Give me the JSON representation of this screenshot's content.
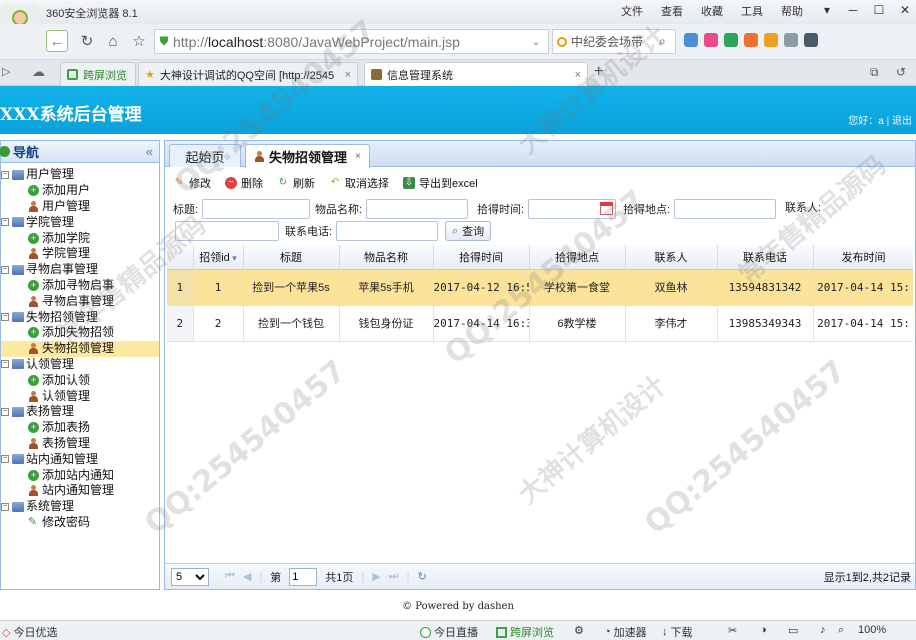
{
  "browser": {
    "name": "360安全浏览器 8.1",
    "menus": [
      "文件",
      "查看",
      "收藏",
      "工具",
      "帮助"
    ],
    "url_prefix": "http://",
    "url_host": "localhost",
    "url_rest": ":8080/JavaWebProject/main.jsp",
    "search_text": "中纪委会场带",
    "tabs": [
      {
        "label": "跨屏浏览"
      },
      {
        "label": "大神设计调试的QQ空间 [http://2545"
      },
      {
        "label": "信息管理系统"
      }
    ]
  },
  "app": {
    "title": "XXX系统后台管理",
    "greeting": "您好：a | 退出"
  },
  "sidebar": {
    "title": "导航",
    "collapse": "«",
    "groups": [
      {
        "label": "用户管理",
        "items": [
          "添加用户",
          "用户管理"
        ]
      },
      {
        "label": "学院管理",
        "items": [
          "添加学院",
          "学院管理"
        ]
      },
      {
        "label": "寻物启事管理",
        "items": [
          "添加寻物启事",
          "寻物启事管理"
        ]
      },
      {
        "label": "失物招领管理",
        "items": [
          "添加失物招领",
          "失物招领管理"
        ]
      },
      {
        "label": "认领管理",
        "items": [
          "添加认领",
          "认领管理"
        ]
      },
      {
        "label": "表扬管理",
        "items": [
          "添加表扬",
          "表扬管理"
        ]
      },
      {
        "label": "站内通知管理",
        "items": [
          "添加站内通知",
          "站内通知管理"
        ]
      },
      {
        "label": "系统管理",
        "items": [
          "修改密码"
        ]
      }
    ],
    "selected": "失物招领管理"
  },
  "main": {
    "tabs": [
      {
        "label": "起始页"
      },
      {
        "label": "失物招领管理",
        "close": "×"
      }
    ],
    "toolbar": {
      "edit": "修改",
      "delete": "删除",
      "refresh": "刷新",
      "cancel_select": "取消选择",
      "export": "导出到excel"
    },
    "search": {
      "title_label": "标题:",
      "item_label": "物品名称:",
      "time_label": "拾得时间:",
      "place_label": "拾得地点:",
      "contact_label": "联系人:",
      "phone_label": "联系电话:",
      "query_label": "查询"
    },
    "table": {
      "columns": [
        "招领id",
        "标题",
        "物品名称",
        "拾得时间",
        "拾得地点",
        "联系人",
        "联系电话",
        "发布时间"
      ],
      "rows": [
        {
          "rownum": "1",
          "id": "1",
          "title": "捡到一个苹果5s",
          "item": "苹果5s手机",
          "time": "2017-04-12 16:5",
          "place": "学校第一食堂",
          "contact": "双鱼林",
          "phone": "13594831342",
          "publish": "2017-04-14 15:"
        },
        {
          "rownum": "2",
          "id": "2",
          "title": "捡到一个钱包",
          "item": "钱包身份证",
          "time": "2017-04-14 16:3",
          "place": "6教学楼",
          "contact": "李伟才",
          "phone": "13985349343",
          "publish": "2017-04-14 15:"
        }
      ]
    },
    "pager": {
      "page_size": "5",
      "page_prefix": "第",
      "page_value": "1",
      "page_suffix": "共1页",
      "info": "显示1到2,共2记录"
    }
  },
  "footer": "© Powered by dashen",
  "statusbar": {
    "left": "今日优选",
    "live": "今日直播",
    "cross": "跨屏浏览",
    "accelerator": "加速器",
    "download": "下载",
    "zoom": "100%"
  },
  "watermarks": [
    "QQ:254540457",
    "大神计算机设计",
    "常年售精品源码"
  ],
  "colors": {
    "header": "#0aa2dc",
    "highlight_row": "#fce39a",
    "selected_tree": "#fde9a0"
  }
}
